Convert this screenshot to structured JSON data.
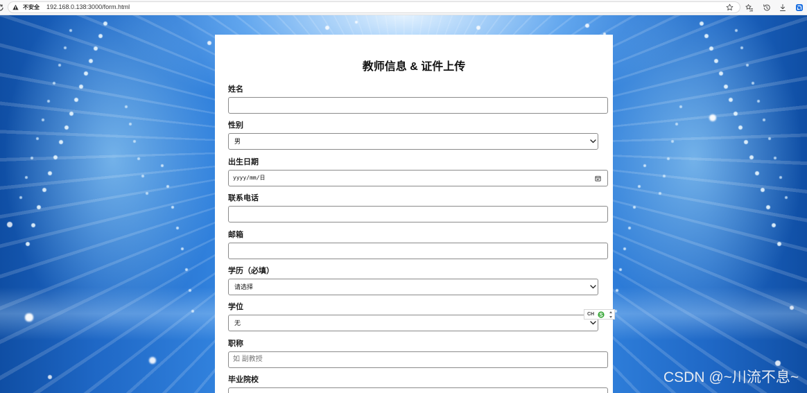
{
  "browser": {
    "security_label": "不安全",
    "url": "192.168.0.138:3000/form.html",
    "toolbar_icons": [
      "reload-icon",
      "warning-icon",
      "bookmark-star-icon",
      "favorites-icon",
      "history-icon",
      "download-icon",
      "browser-extension-icon"
    ]
  },
  "form": {
    "title": "教师信息 & 证件上传",
    "fields": [
      {
        "label": "姓名",
        "value": ""
      },
      {
        "label": "性别",
        "value": "男",
        "icon": "chevron-down-icon"
      },
      {
        "label": "出生日期",
        "placeholder": "yyyy/mm/日",
        "icon": "calendar-icon"
      },
      {
        "label": "联系电话",
        "value": ""
      },
      {
        "label": "邮箱",
        "value": ""
      },
      {
        "label": "学历（必填）",
        "value": "请选择",
        "icon": "chevron-down-icon"
      },
      {
        "label": "学位",
        "value": "无",
        "icon": "chevron-down-icon"
      },
      {
        "label": "职称",
        "placeholder": "如 副教授"
      },
      {
        "label": "毕业院校",
        "value": ""
      }
    ]
  },
  "ime_indicator": {
    "label": "CH",
    "icon": "input-method-logo-icon"
  },
  "watermark": "CSDN @~川流不息~",
  "colors": {
    "panel_background": "#ffffff",
    "page_background": "#2f80dc",
    "ime_logo_green": "#3aa83a",
    "extension_icon_blue": "#1b6fe0"
  }
}
